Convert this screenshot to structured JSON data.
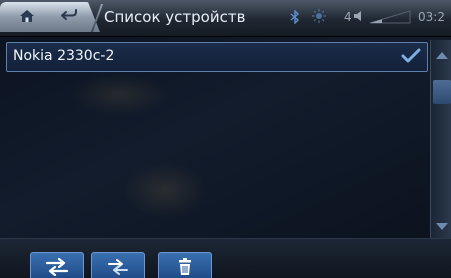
{
  "header": {
    "title": "Список устройств",
    "signal_level": "4",
    "clock": "03:2"
  },
  "icons": {
    "home": "home-icon",
    "back": "back-icon",
    "bluetooth": "bluetooth-icon",
    "brightness": "sun-icon",
    "check": "check-icon",
    "scroll_up": "chevron-up-icon",
    "scroll_down": "chevron-down-icon",
    "swap": "swap-arrows-icon",
    "sync": "sync-arrows-icon",
    "trash": "trash-icon"
  },
  "devices": [
    {
      "name": "Nokia 2330c-2",
      "selected": true
    }
  ],
  "colors": {
    "accent": "#3a6fb0",
    "check": "#7fb0e0"
  }
}
